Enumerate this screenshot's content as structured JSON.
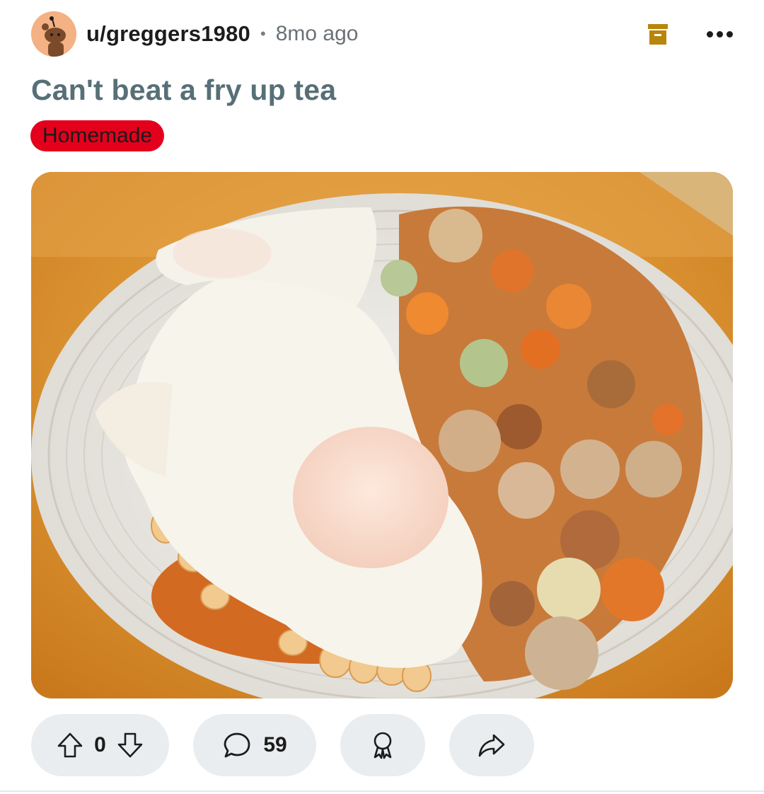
{
  "post": {
    "author": "u/greggers1980",
    "separator": "•",
    "age": "8mo ago",
    "title": "Can't beat a fry up tea",
    "flair": "Homemade",
    "flair_color": "#e4001d",
    "image_alt": "Plate with fried eggs, baked beans and roasted vegetables"
  },
  "actions": {
    "score": "0",
    "comments": "59"
  },
  "icons": [
    "avatar-icon",
    "archive-icon",
    "more-options-icon",
    "upvote-icon",
    "downvote-icon",
    "comment-icon",
    "award-icon",
    "share-icon"
  ],
  "colors": {
    "title": "#576f76",
    "archive": "#b8860b",
    "pill_bg": "#eaedef"
  }
}
